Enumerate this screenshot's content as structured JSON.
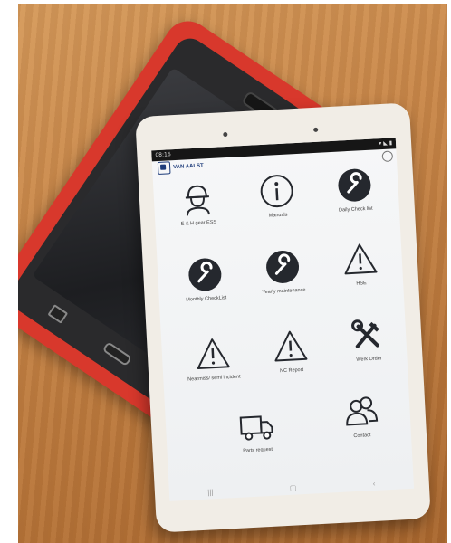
{
  "photo": {
    "back_tablet": {
      "case_color": "#d8382c"
    },
    "front_tablet": {
      "frame_color": "#f1ede6"
    }
  },
  "screen": {
    "status_time": "08:16",
    "brand": "VAN AALST",
    "tiles": [
      {
        "icon": "worker-helmet-icon",
        "label": "E & H gear ESS"
      },
      {
        "icon": "info-icon",
        "label": "Manuals"
      },
      {
        "icon": "wrench-icon",
        "label": "Daily Check list"
      },
      {
        "icon": "wrench-icon",
        "label": "Monthly CheckList"
      },
      {
        "icon": "wrench-icon",
        "label": "Yearly maintenance"
      },
      {
        "icon": "warning-icon",
        "label": "HSE"
      },
      {
        "icon": "warning-icon",
        "label": "Nearmiss/ semi incident"
      },
      {
        "icon": "warning-icon",
        "label": "NC Report"
      },
      {
        "icon": "tools-icon",
        "label": "Werk Order"
      },
      {
        "icon": "truck-icon",
        "label": "Parts request"
      },
      {
        "icon": "users-icon",
        "label": "Contact"
      }
    ]
  }
}
